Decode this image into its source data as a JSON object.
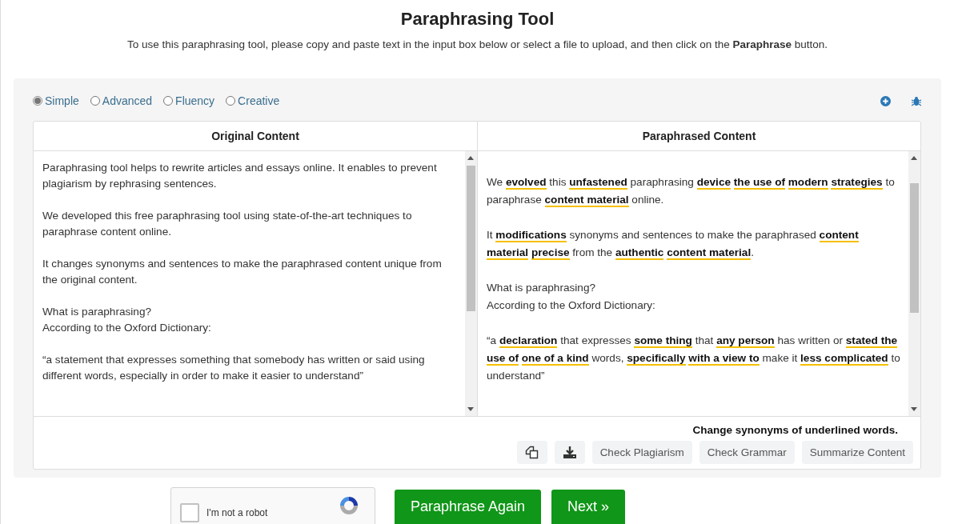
{
  "page": {
    "title": "Paraphrasing Tool",
    "intro": "To use this paraphrasing tool, please copy and paste text in the input box below or select a file to upload, and then click on the **Paraphrase** button."
  },
  "modes": [
    {
      "label": "Simple",
      "selected": true
    },
    {
      "label": "Advanced",
      "selected": false
    },
    {
      "label": "Fluency",
      "selected": false
    },
    {
      "label": "Creative",
      "selected": false
    }
  ],
  "original": {
    "heading": "Original Content",
    "paragraphs": [
      "Paraphrasing tool helps to rewrite articles and essays online. It enables to prevent plagiarism by rephrasing sentences.",
      "We developed this free paraphrasing tool using state-of-the-art techniques to paraphrase content online.",
      "It changes synonyms and sentences to make the paraphrased content unique from the original content.",
      "What is paraphrasing?\nAccording to the Oxford Dictionary:",
      "“a statement that expresses something that somebody has written or said using different words, especially in order to make it easier to understand”"
    ]
  },
  "paraphrased": {
    "heading": "Paraphrased Content",
    "paragraphs": [
      "We **evolved** this **unfastened** paraphrasing **device** **the use of** **modern** **strategies** to paraphrase **content material** online.",
      "It **modifications** synonyms and sentences to make the paraphrased **content material** **precise** from the **authentic** **content material**.",
      "What is paraphrasing?\nAccording to the Oxford Dictionary:",
      "“a **declaration** that expresses **some thing** that **any person** has written or **stated the use of** **one of a kind** words, **specifically** **with a view to** make it **less complicated** to understand”"
    ]
  },
  "hint": "Change synonyms of underlined words.",
  "actions": [
    "Check Plagiarism",
    "Check Grammar",
    "Summarize Content"
  ],
  "captcha": {
    "label": "I'm not a robot",
    "checked": false
  },
  "buttons": [
    "Paraphrase Again",
    "Next »"
  ]
}
